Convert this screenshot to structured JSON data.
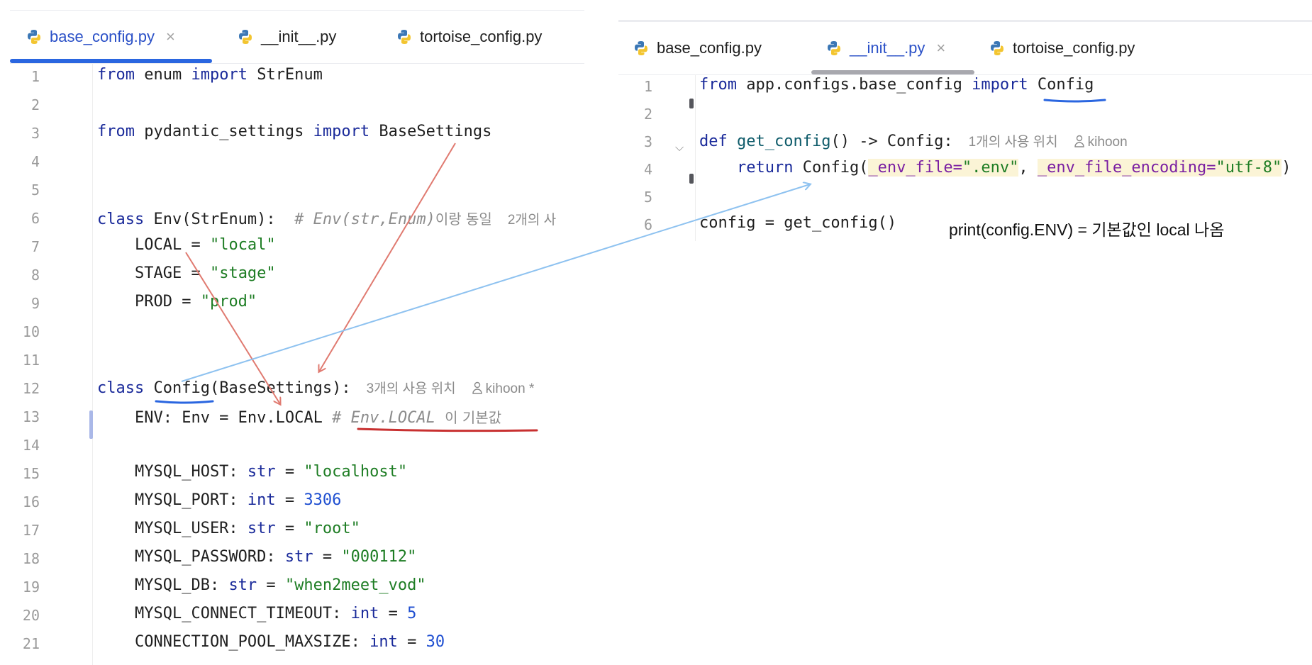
{
  "left": {
    "tabs": [
      {
        "label": "base_config.py",
        "active": true,
        "closable": true
      },
      {
        "label": "__init__.py",
        "active": false,
        "closable": false
      },
      {
        "label": "tortoise_config.py",
        "active": false,
        "closable": false
      }
    ],
    "line_numbers": [
      "1",
      "2",
      "3",
      "4",
      "5",
      "6",
      "7",
      "8",
      "9",
      "10",
      "11",
      "12",
      "13",
      "14",
      "15",
      "16",
      "17",
      "18",
      "19",
      "20",
      "21"
    ],
    "code": {
      "l1": {
        "kw1": "from",
        "t1": " enum ",
        "kw2": "import",
        "t2": " StrEnum"
      },
      "l3": {
        "kw1": "from",
        "t1": " pydantic_settings ",
        "kw2": "import",
        "t2": " BaseSettings"
      },
      "l6": {
        "kw": "class",
        "t": " Env(StrEnum):  ",
        "cmt": "# Env(str,Enum)",
        "cmt_kr": "이랑 동일",
        "hint": "2개의 사"
      },
      "l7": {
        "t": "    LOCAL = ",
        "s": "\"local\""
      },
      "l8": {
        "t": "    STAGE = ",
        "s": "\"stage\""
      },
      "l9": {
        "t": "    PROD = ",
        "s": "\"prod\""
      },
      "l12": {
        "kw": "class",
        "t1": " ",
        "name": "Config",
        "t2": "(BaseSettings):",
        "hint_usages": "3개의 사용 위치",
        "hint_author": "kihoon *"
      },
      "l13": {
        "t": "    ENV: Env = Env.LOCAL ",
        "cmt": "# Env.LOCAL ",
        "cmt_kr": "이 기본값"
      },
      "l15": {
        "t": "    MYSQL_HOST: ",
        "type": "str",
        "eq": " = ",
        "s": "\"localhost\""
      },
      "l16": {
        "t": "    MYSQL_PORT: ",
        "type": "int",
        "eq": " = ",
        "n": "3306"
      },
      "l17": {
        "t": "    MYSQL_USER: ",
        "type": "str",
        "eq": " = ",
        "s": "\"root\""
      },
      "l18": {
        "t": "    MYSQL_PASSWORD: ",
        "type": "str",
        "eq": " = ",
        "s": "\"000112\""
      },
      "l19": {
        "t": "    MYSQL_DB: ",
        "type": "str",
        "eq": " = ",
        "s": "\"when2meet_vod\""
      },
      "l20": {
        "t": "    MYSQL_CONNECT_TIMEOUT: ",
        "type": "int",
        "eq": " = ",
        "n": "5"
      },
      "l21": {
        "t": "    CONNECTION_POOL_MAXSIZE: ",
        "type": "int",
        "eq": " = ",
        "n": "30"
      }
    }
  },
  "right": {
    "tabs": [
      {
        "label": "base_config.py",
        "active": false,
        "closable": false
      },
      {
        "label": "__init__.py",
        "active": true,
        "closable": true
      },
      {
        "label": "tortoise_config.py",
        "active": false,
        "closable": false
      }
    ],
    "line_numbers": [
      "1",
      "2",
      "3",
      "4",
      "5",
      "6"
    ],
    "code": {
      "l1": {
        "kw1": "from",
        "t1": " app.configs.base_config ",
        "kw2": "import",
        "t2": " ",
        "name": "Config"
      },
      "l3": {
        "kw": "def",
        "t1": " ",
        "fn": "get_config",
        "t2": "() -> Config:",
        "hint_usages": "1개의 사용 위치",
        "hint_author": "kihoon"
      },
      "l4": {
        "indent": "    ",
        "kw": "return",
        "t1": " Config(",
        "p1": "_env_file=",
        "s1": "\".env\"",
        "comma": ", ",
        "p2": "_env_file_encoding=",
        "s2": "\"utf-8\"",
        "close": ")"
      },
      "l6": {
        "t": "config = get_config()"
      }
    },
    "annotation": "print(config.ENV) = 기본값인 local 나옴"
  },
  "colors": {
    "accent_blue": "#2a66e0",
    "arrow_red": "#e07a70",
    "arrow_blue": "#8ec2f0",
    "underline_red": "#c83030",
    "tab_inactive_underline": "#a8a8ae"
  }
}
